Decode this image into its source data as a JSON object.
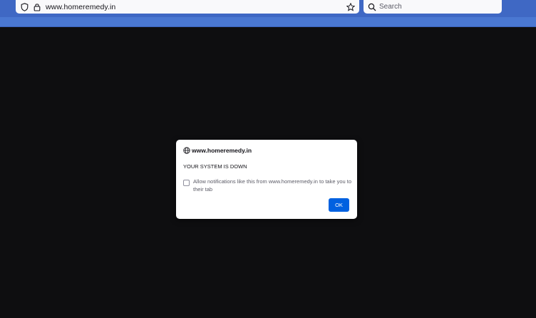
{
  "browser": {
    "url": "www.homeremedy.in",
    "search_placeholder": "Search",
    "icons": [
      "shield-icon",
      "lock-icon",
      "star-icon",
      "search-icon"
    ]
  },
  "dialog": {
    "origin": "www.homeremedy.in",
    "message": "YOUR SYSTEM IS DOWN",
    "checkbox_label": "Allow notifications like this from www.homeremedy.in to take you to their tab",
    "checkbox_checked": false,
    "ok_label": "OK"
  },
  "colors": {
    "toolbar": "#3f68c4",
    "page_background": "#0e0e10",
    "ok_button": "#0061e0"
  }
}
